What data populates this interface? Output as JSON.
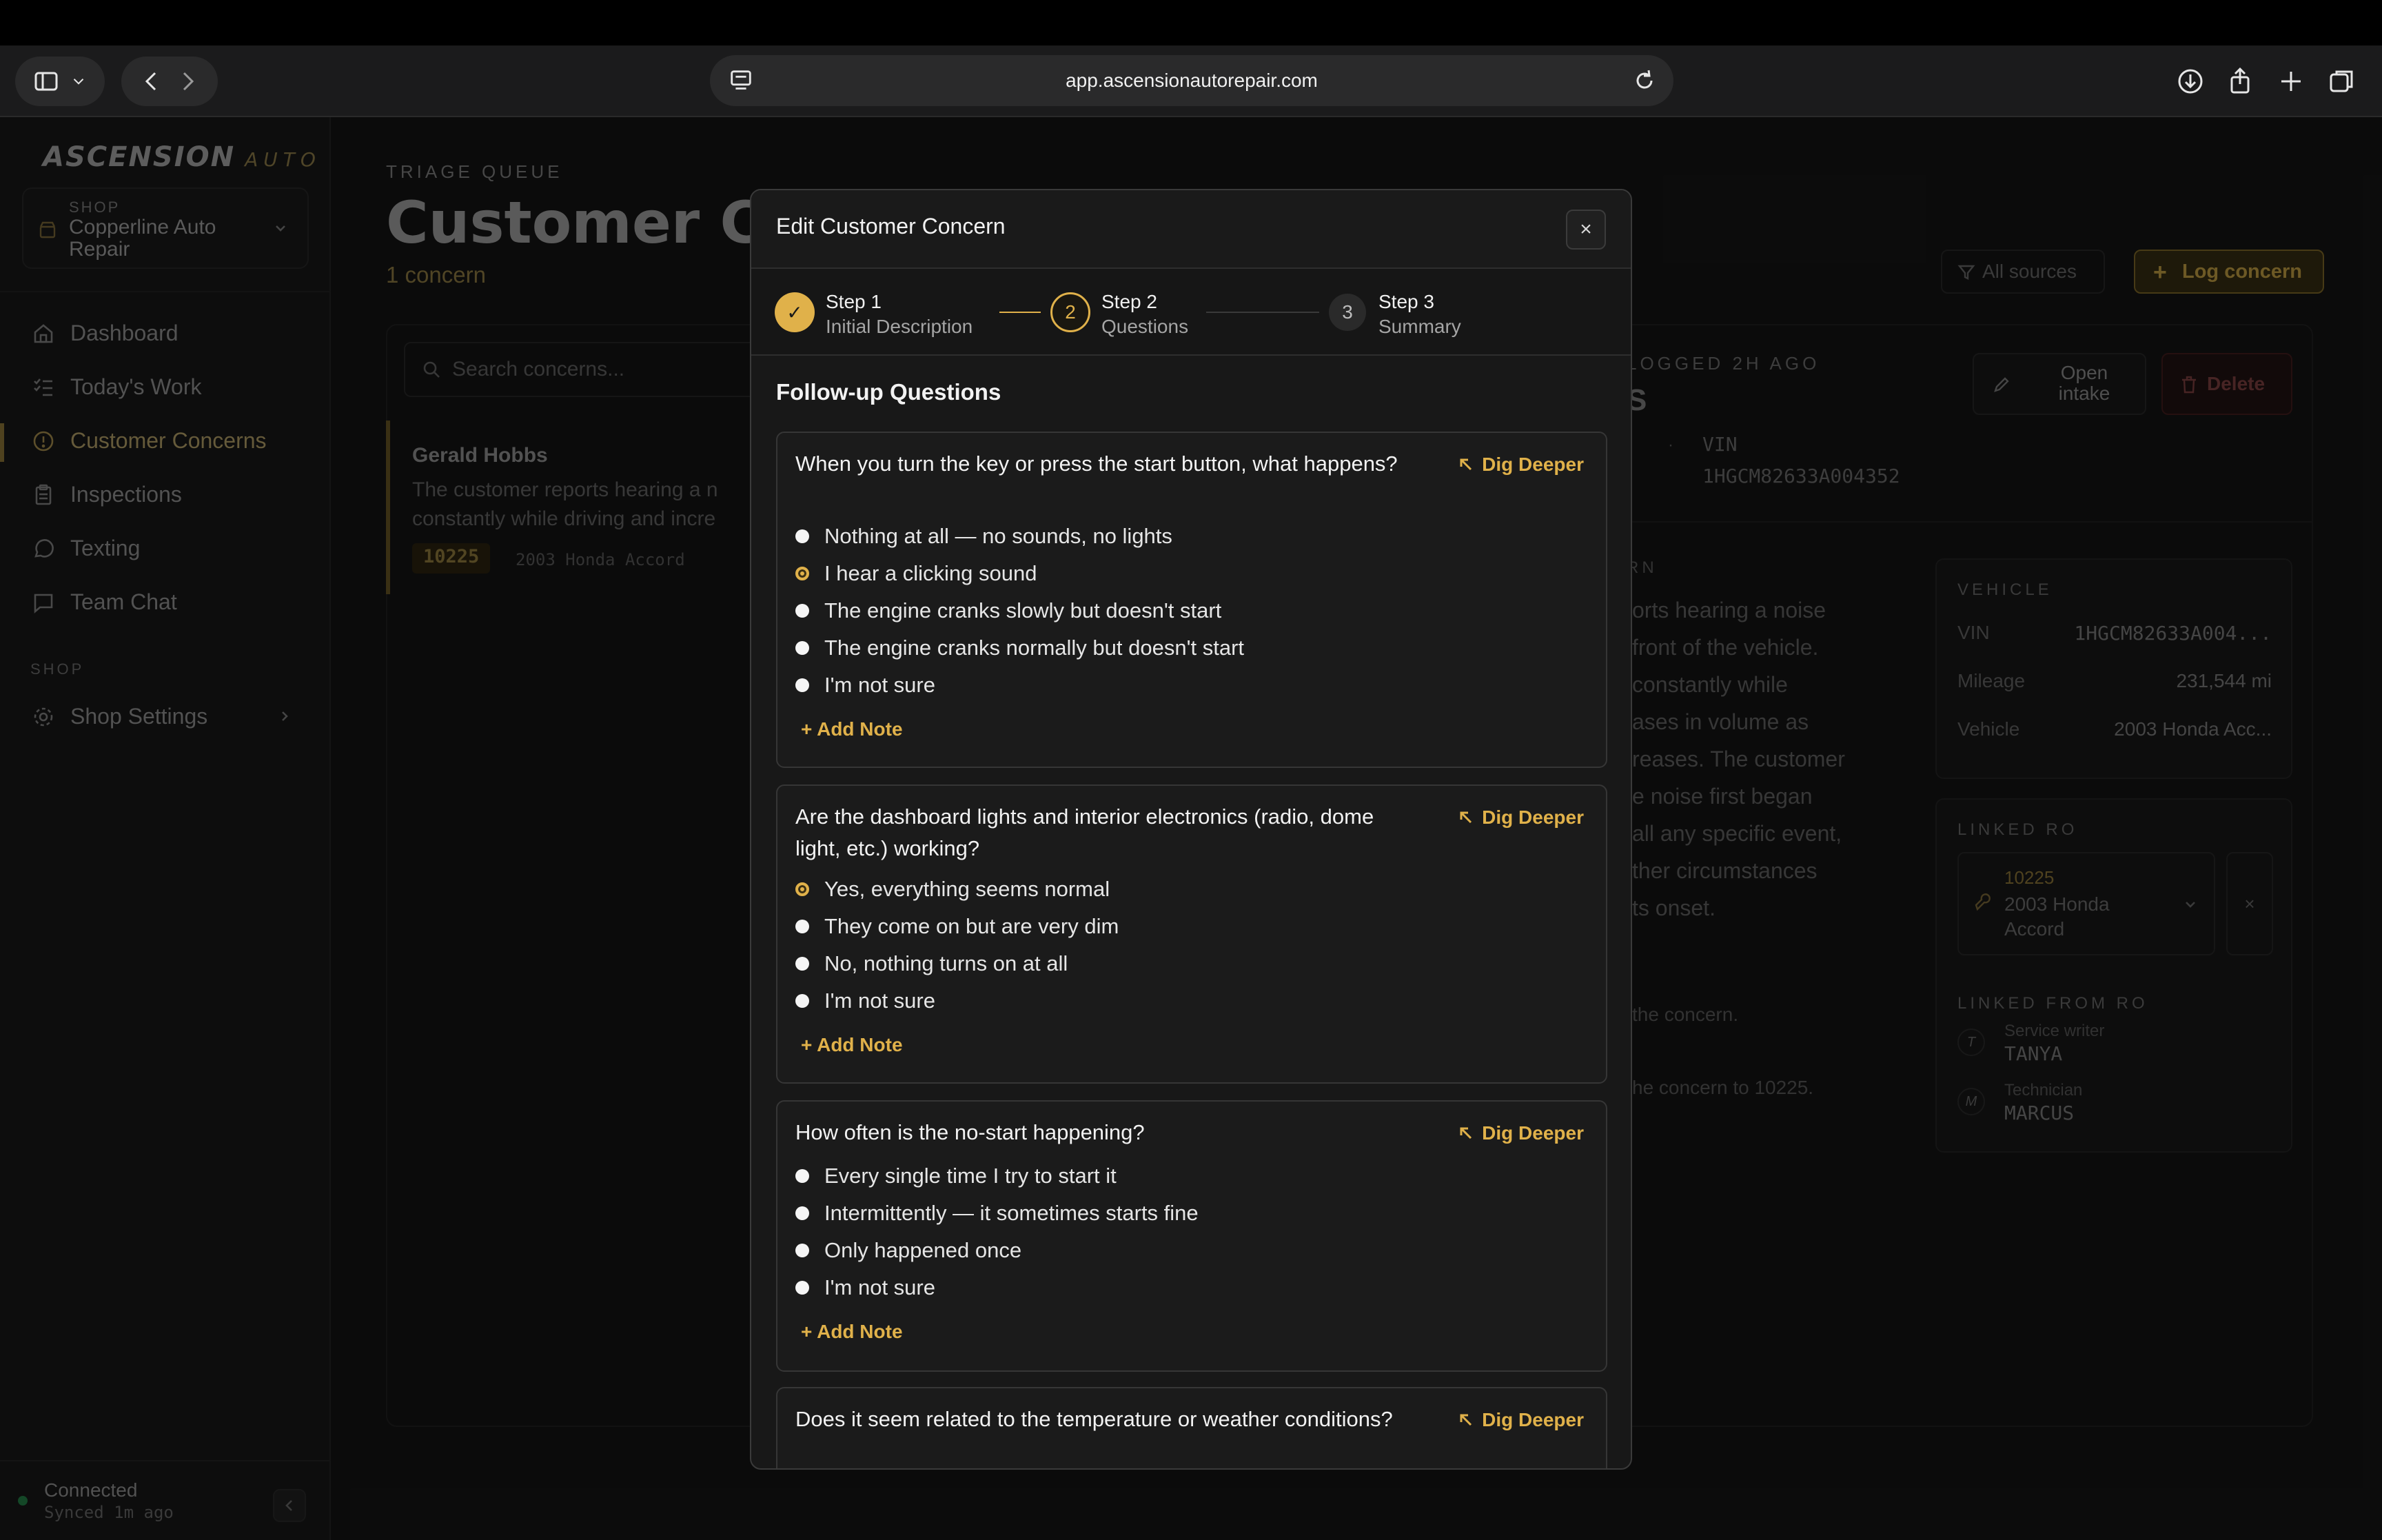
{
  "browser": {
    "url": "app.ascensionautorepair.com"
  },
  "sidebar": {
    "logo_main": "ASCENSION",
    "logo_sub": "AUTO",
    "shop_label": "SHOP",
    "shop_name": "Copperline Auto Repair",
    "nav": [
      {
        "label": "Dashboard"
      },
      {
        "label": "Today's Work"
      },
      {
        "label": "Customer Concerns"
      },
      {
        "label": "Inspections"
      },
      {
        "label": "Texting"
      },
      {
        "label": "Team Chat"
      }
    ],
    "section_shop": "SHOP",
    "shop_settings": "Shop Settings",
    "status": "Connected",
    "synced": "Synced 1m ago"
  },
  "page": {
    "eyebrow": "TRIAGE QUEUE",
    "title": "Customer Co",
    "count": "1 concern",
    "search_placeholder": "Search concerns...",
    "filter_label": "All sources",
    "log_button": "Log concern",
    "concern": {
      "name": "Gerald Hobbs",
      "snippet1": "The customer reports hearing a n",
      "snippet2": "constantly while driving and incre",
      "ro": "10225",
      "vehicle": "2003 Honda Accord"
    },
    "detail": {
      "logged": "LOGGED 2H AGO",
      "s_letter": "S",
      "vin_label": "VIN",
      "vin_value": "1HGCM82633A004352",
      "open_intake": "Open intake",
      "delete": "Delete",
      "rn": "RN",
      "desc": [
        "orts hearing a noise",
        "front of the vehicle.",
        "constantly while",
        "ases in volume as",
        "reases. The customer",
        "e noise first began",
        "all any specific event,",
        "ther circumstances",
        "ts onset."
      ],
      "note1": "the concern.",
      "note2": "he concern to 10225.",
      "vehicle_heading": "VEHICLE",
      "vehicle_rows": [
        {
          "k": "VIN",
          "v": "1HGCM82633A004..."
        },
        {
          "k": "Mileage",
          "v": "231,544 mi"
        },
        {
          "k": "Vehicle",
          "v": "2003 Honda Acc..."
        }
      ],
      "linked_ro_heading": "LINKED RO",
      "linked_ro_num": "10225",
      "linked_ro_vehicle": "2003 Honda Accord",
      "linked_from_heading": "LINKED FROM RO",
      "people": [
        {
          "initial": "T",
          "role": "Service writer",
          "name": "TANYA"
        },
        {
          "initial": "M",
          "role": "Technician",
          "name": "MARCUS"
        }
      ]
    }
  },
  "modal": {
    "title": "Edit Customer Concern",
    "close": "×",
    "steps": [
      {
        "num": "✓",
        "label": "Step 1",
        "sub": "Initial Description",
        "state": "done"
      },
      {
        "num": "2",
        "label": "Step 2",
        "sub": "Questions",
        "state": "active"
      },
      {
        "num": "3",
        "label": "Step 3",
        "sub": "Summary",
        "state": "pending"
      }
    ],
    "section_title": "Follow-up Questions",
    "dig_label": "Dig Deeper",
    "add_note": "+ Add Note",
    "questions": [
      {
        "text": "When you turn the key or press the start button, what happens?",
        "options": [
          "Nothing at all — no sounds, no lights",
          "I hear a clicking sound",
          "The engine cranks slowly but doesn't start",
          "The engine cranks normally but doesn't start",
          "I'm not sure"
        ],
        "selected": 1
      },
      {
        "text": "Are the dashboard lights and interior electronics (radio, dome light, etc.) working?",
        "options": [
          "Yes, everything seems normal",
          "They come on but are very dim",
          "No, nothing turns on at all",
          "I'm not sure"
        ],
        "selected": 0
      },
      {
        "text": "How often is the no-start happening?",
        "options": [
          "Every single time I try to start it",
          "Intermittently — it sometimes starts fine",
          "Only happened once",
          "I'm not sure"
        ],
        "selected": -1
      },
      {
        "text": "Does it seem related to the temperature or weather conditions?",
        "options": [],
        "selected": -1
      }
    ],
    "colors": {
      "accent": "#e0b14a"
    }
  }
}
